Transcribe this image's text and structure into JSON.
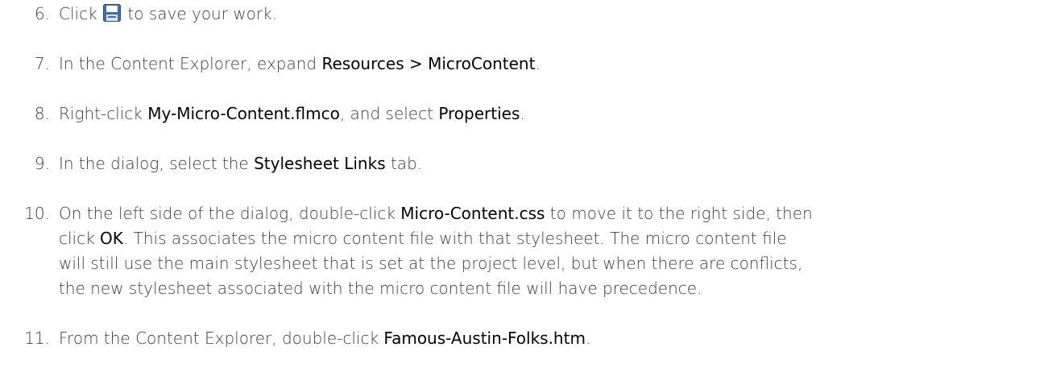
{
  "steps": [
    {
      "number": "6.",
      "before_icon": "Click ",
      "icon": "save-icon",
      "after_icon": " to save your work."
    },
    {
      "number": "7.",
      "t1": "In the Content Explorer, expand ",
      "b1": "Resources > MicroContent",
      "t2": "."
    },
    {
      "number": "8.",
      "t1": "Right-click ",
      "b1": "My-Micro-Content.flmco",
      "t2": ", and select ",
      "b2": "Properties",
      "t3": "."
    },
    {
      "number": "9.",
      "t1": "In the dialog, select the ",
      "b1": "Stylesheet Links",
      "t2": " tab."
    },
    {
      "number": "10.",
      "t1": "On the left side of the dialog, double-click ",
      "b1": "Micro-Content.css",
      "t2": " to move it to the right side, then",
      "l2a": "click ",
      "b2": "OK",
      "l2b": ". This associates the micro content file with that stylesheet. The micro content file",
      "l3": "will still use the main stylesheet that is set at the project level, but when there are conflicts,",
      "l4": "the new stylesheet associated with the micro content file will have precedence."
    },
    {
      "number": "11.",
      "t1": "From the Content Explorer, double-click ",
      "b1": "Famous-Austin-Folks.htm",
      "t2": "."
    }
  ],
  "colors": {
    "text": "#3c3c3c",
    "emphasis": "#000000",
    "icon_blue": "#3a6fb5"
  }
}
